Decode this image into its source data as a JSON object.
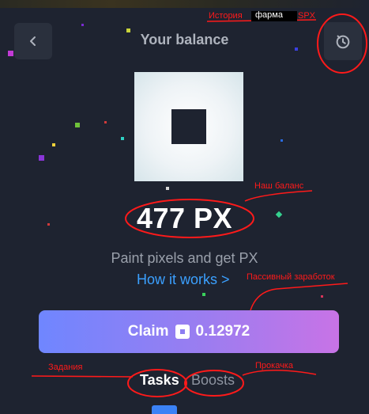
{
  "header": {
    "title": "Your balance",
    "back_icon": "chevron-left-icon",
    "history_icon": "clock-history-icon"
  },
  "balance": {
    "text": "477 PX"
  },
  "subtitle": "Paint pixels and get PX",
  "how_it_works": "How it works >",
  "claim": {
    "label": "Claim",
    "amount": "0.12972"
  },
  "tabs": [
    {
      "label": "Tasks",
      "active": true
    },
    {
      "label": "Boosts",
      "active": false
    }
  ],
  "annotations": {
    "history": "История",
    "farm": "фарма",
    "spx": "SPX",
    "balance": "Наш баланс",
    "passive": "Пассивный заработок",
    "tasks": "Задания",
    "boosts": "Прокачка"
  },
  "colors": {
    "background": "#1e2330",
    "accent_start": "#6f86ff",
    "accent_end": "#c873e6",
    "link": "#3ba0ff",
    "annotation": "#ff1a1a"
  }
}
